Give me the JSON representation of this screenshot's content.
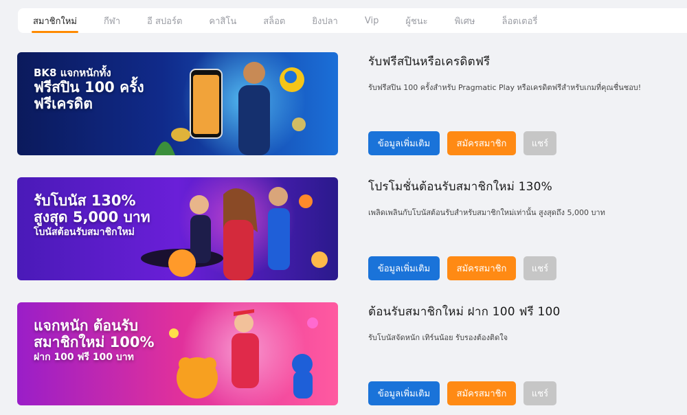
{
  "tabs": [
    {
      "label": "สมาชิกใหม่",
      "active": true
    },
    {
      "label": "กีฬา"
    },
    {
      "label": "อี สปอร์ต"
    },
    {
      "label": "คาสิโน"
    },
    {
      "label": "สล็อต"
    },
    {
      "label": "ยิงปลา"
    },
    {
      "label": "Vip"
    },
    {
      "label": "ผู้ชนะ"
    },
    {
      "label": "พิเศษ"
    },
    {
      "label": "ล็อตเตอรี่"
    }
  ],
  "buttons": {
    "more": "ข้อมูลเพิ่มเติม",
    "join": "สมัครสมาชิก",
    "share": "แชร์"
  },
  "promos": [
    {
      "banner": {
        "line1": "BK8 แจกหนักทั้ง",
        "line2": "ฟรีสปิน 100 ครั้ง",
        "line3": "ฟรีเครดิต"
      },
      "title": "รับฟรีสปินหรือเครดิตฟรี",
      "desc": "รับฟรีสปิน 100 ครั้งสำหรับ Pragmatic Play หรือเครดิตฟรีสำหรับเกมที่คุณชื่นชอบ!"
    },
    {
      "banner": {
        "line1": "รับโบนัส 130%",
        "line2": "สูงสุด 5,000 บาท",
        "line3": "โบนัสต้อนรับสมาชิกใหม่"
      },
      "title": "โปรโมชั่นต้อนรับสมาชิกใหม่ 130%",
      "desc": "เพลิดเพลินกับโบนัสต้อนรับสำหรับสมาชิกใหม่เท่านั้น สูงสุดถึง 5,000 บาท"
    },
    {
      "banner": {
        "line1": "แจกหนัก ต้อนรับ",
        "line2": "สมาชิกใหม่ 100%",
        "line3": "ฝาก 100 ฟรี 100 บาท"
      },
      "title": "ต้อนรับสมาชิกใหม่ ฝาก 100 ฟรี 100",
      "desc": "รับโบนัสจัดหนัก เทิร์นน้อย รับรองต้องติดใจ"
    }
  ],
  "colors": {
    "accent": "#ff8a00",
    "primary_button": "#1a73d9",
    "join_button": "#ff8a14",
    "share_button": "#c6c6c6"
  }
}
